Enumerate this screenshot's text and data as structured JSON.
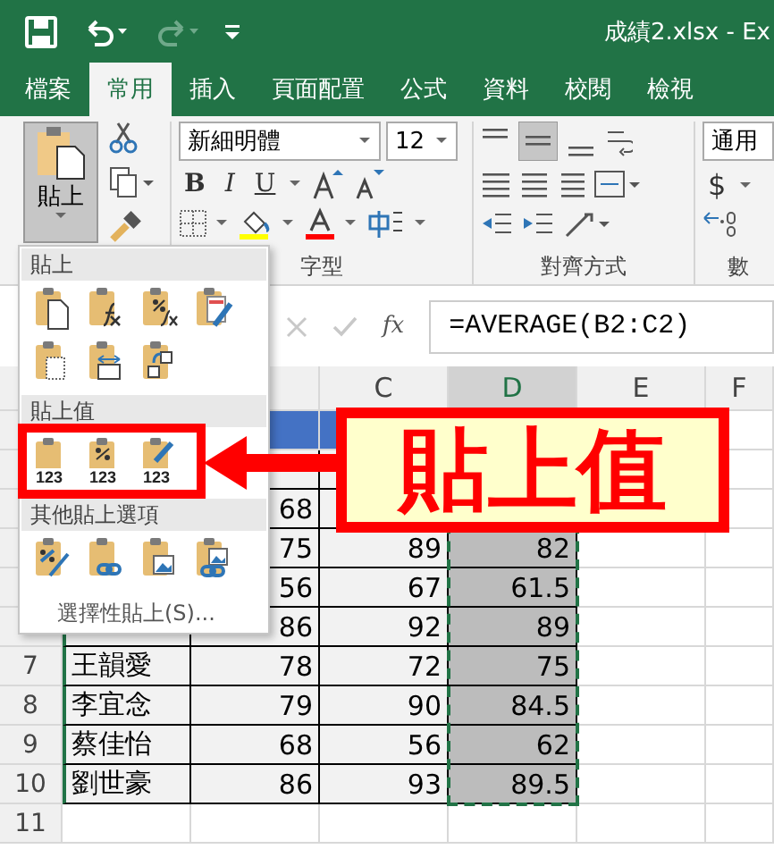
{
  "title_bar": {
    "title": "成績2.xlsx  -  Ex"
  },
  "tabs": [
    {
      "label": "檔案",
      "selected": false
    },
    {
      "label": "常用",
      "selected": true
    },
    {
      "label": "插入",
      "selected": false
    },
    {
      "label": "頁面配置",
      "selected": false
    },
    {
      "label": "公式",
      "selected": false
    },
    {
      "label": "資料",
      "selected": false
    },
    {
      "label": "校閱",
      "selected": false
    },
    {
      "label": "檢視",
      "selected": false
    }
  ],
  "ribbon": {
    "paste_button": {
      "label": "貼上",
      "selected": true
    },
    "font_name": "新細明體",
    "font_size": "12",
    "bold": "B",
    "italic": "I",
    "underline": "U",
    "number_format": "通用",
    "currency": "$",
    "groups": [
      {
        "label": "字型"
      },
      {
        "label": "對齊方式"
      },
      {
        "label": "數"
      }
    ]
  },
  "formula_bar": {
    "fx": "fx",
    "formula": "=AVERAGE(B2:C2)"
  },
  "columns": [
    {
      "label": "C",
      "selected": false
    },
    {
      "label": "D",
      "selected": true
    },
    {
      "label": "E",
      "selected": false
    },
    {
      "label": "F",
      "selected": false
    }
  ],
  "rows": [
    {
      "kind": "header"
    },
    {
      "kind": "data"
    },
    {
      "kind": "data",
      "b": "68"
    },
    {
      "kind": "data",
      "b": "75",
      "c": "89",
      "d": "82"
    },
    {
      "kind": "data",
      "b": "56",
      "c": "67",
      "d": "61.5"
    },
    {
      "kind": "data",
      "b": "86",
      "c": "92",
      "d": "89"
    },
    {
      "kind": "data",
      "number": "7",
      "a": "王韻愛",
      "b": "78",
      "c": "72",
      "d": "75"
    },
    {
      "kind": "data",
      "number": "8",
      "a": "李宜念",
      "b": "79",
      "c": "90",
      "d": "84.5"
    },
    {
      "kind": "data",
      "number": "9",
      "a": "蔡佳怡",
      "b": "68",
      "c": "56",
      "d": "62"
    },
    {
      "kind": "data",
      "number": "10",
      "a": "劉世豪",
      "b": "86",
      "c": "93",
      "d": "89.5"
    },
    {
      "kind": "empty",
      "number": "11"
    }
  ],
  "paste_menu": {
    "sections": [
      {
        "title": "貼上",
        "highlighted": false,
        "options": [
          {
            "kind": "doc"
          },
          {
            "kind": "formula"
          },
          {
            "kind": "formula-percent"
          },
          {
            "kind": "brush"
          },
          {
            "kind": "grid"
          },
          {
            "kind": "widths"
          },
          {
            "kind": "transpose"
          }
        ]
      },
      {
        "title": "貼上值",
        "highlighted": true,
        "options": [
          {
            "kind": "values",
            "caption": "123"
          },
          {
            "kind": "values-percent",
            "caption": "123"
          },
          {
            "kind": "values-brush",
            "caption": "123"
          }
        ]
      },
      {
        "title": "其他貼上選項",
        "highlighted": false,
        "options": [
          {
            "kind": "percent-brush"
          },
          {
            "kind": "link"
          },
          {
            "kind": "picture"
          },
          {
            "kind": "linked-picture"
          }
        ]
      }
    ],
    "special": "選擇性貼上(S)..."
  },
  "callout": {
    "text": "貼上值"
  }
}
